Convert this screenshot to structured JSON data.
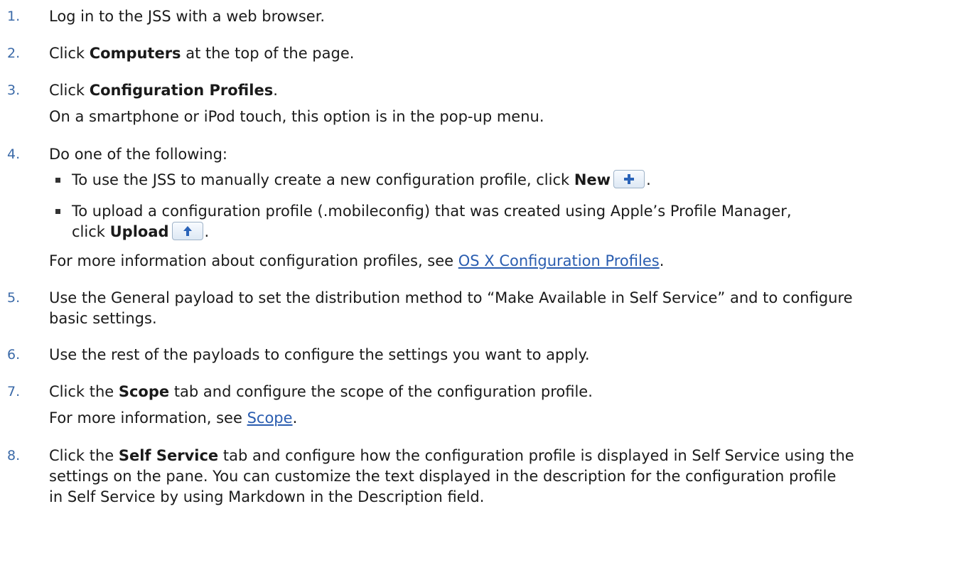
{
  "steps": [
    {
      "num": "1.",
      "text": "Log in to the JSS with a web browser."
    },
    {
      "num": "2.",
      "pre": "Click ",
      "bold": "Computers",
      "post": " at the top of the page."
    },
    {
      "num": "3.",
      "pre": "Click ",
      "bold": "Configuration Profiles",
      "post": ".",
      "note": "On a smartphone or iPod touch, this option is in the pop-up menu."
    },
    {
      "num": "4.",
      "text": "Do one of the following:",
      "bullets": [
        {
          "pre": "To use the JSS to manually create a new configuration profile, click ",
          "bold": "New",
          "post": ".",
          "icon": "plus-icon"
        },
        {
          "line1": "To upload a configuration profile (.mobileconfig) that was created using Apple’s Profile Manager,",
          "pre": "click ",
          "bold": "Upload",
          "post": ".",
          "icon": "upload-arrow-icon"
        }
      ],
      "more_pre": "For more information about configuration profiles, see ",
      "more_link": "OS X Configuration Profiles",
      "more_post": "."
    },
    {
      "num": "5.",
      "line1": "Use the General payload to set the distribution method to “Make Available in Self Service” and to configure",
      "line2": "basic settings."
    },
    {
      "num": "6.",
      "text": "Use the rest of the payloads to configure the settings you want to apply."
    },
    {
      "num": "7.",
      "pre": "Click the ",
      "bold": "Scope",
      "post": " tab and configure the scope of the configuration profile.",
      "more_pre": "For more information, see ",
      "more_link": "Scope",
      "more_post": "."
    },
    {
      "num": "8.",
      "pre": "Click the ",
      "bold": "Self Service",
      "post": " tab and configure how the configuration profile is displayed in Self Service using the",
      "line2": "settings on the pane. You can customize the text displayed in the description for the configuration profile",
      "line3": "in Self Service by using Markdown in the Description field."
    }
  ],
  "colors": {
    "number": "#3b6aa8",
    "link": "#2a5db0",
    "button_border": "#9fb3c8",
    "button_icon": "#2a63b8"
  }
}
